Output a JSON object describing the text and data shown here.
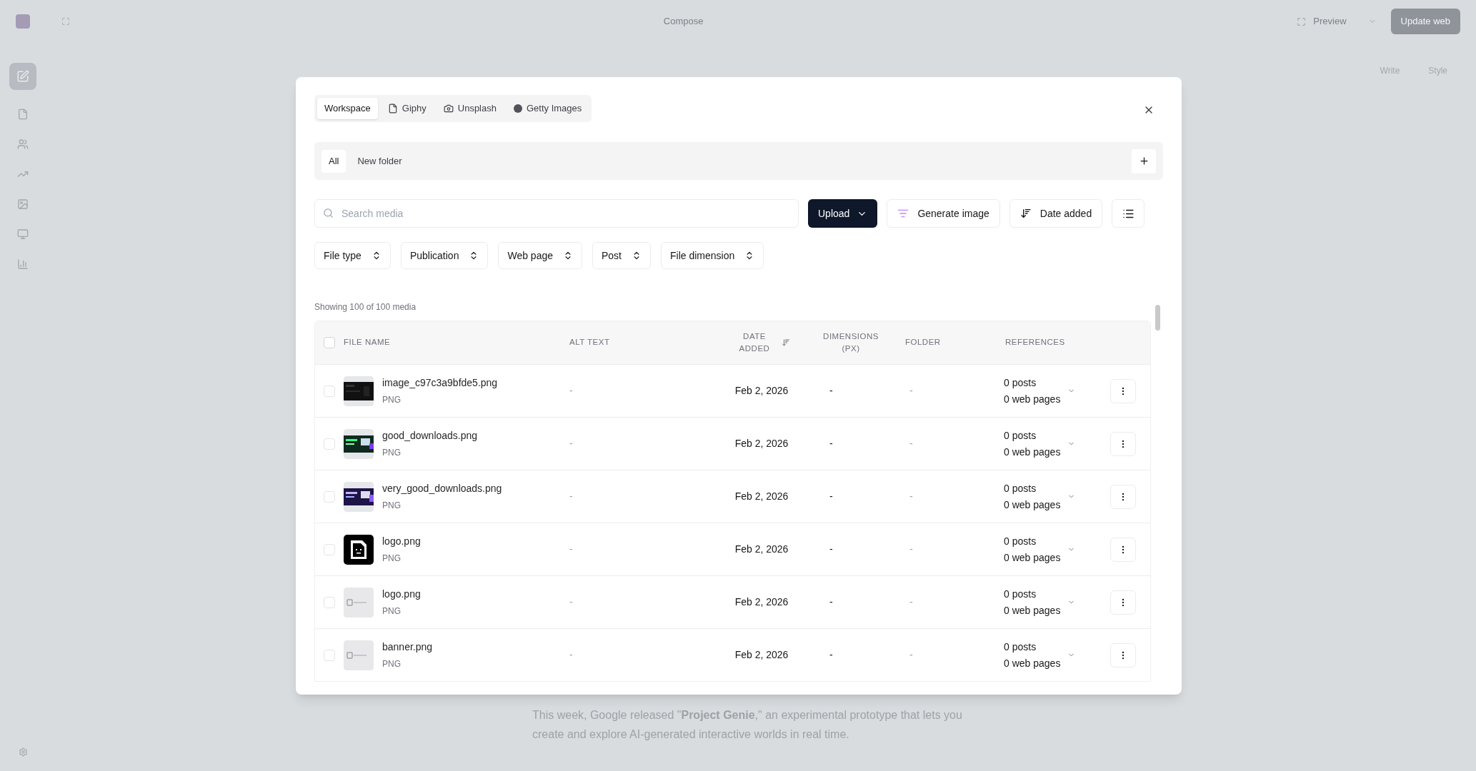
{
  "app": {
    "title": "Compose",
    "preview": "Preview",
    "update_button": "Update web",
    "panel_tabs": [
      "Write",
      "Style"
    ],
    "body_text": "This week, Google released \"**Project Genie**,\" an experimental prototype that lets you create and explore AI-generated interactive worlds in real time."
  },
  "dialog": {
    "source_tabs": [
      {
        "label": "Workspace",
        "selected": true,
        "kind": "workspace"
      },
      {
        "label": "Giphy",
        "selected": false,
        "kind": "file"
      },
      {
        "label": "Unsplash",
        "selected": false,
        "kind": "camera"
      },
      {
        "label": "Getty Images",
        "selected": false,
        "kind": "getty"
      }
    ],
    "folders": [
      {
        "label": "All",
        "selected": true
      },
      {
        "label": "New folder",
        "selected": false
      }
    ],
    "search": {
      "placeholder": "Search media"
    },
    "upload_button": "Upload",
    "generate_button": "Generate image",
    "sort_button": "Date added",
    "filters": [
      "File type",
      "Publication",
      "Web page",
      "Post",
      "File dimension"
    ],
    "count": "Showing 100 of 100 media",
    "table": {
      "select_all_checked": false,
      "columns": [
        "FILE NAME",
        "ALT TEXT",
        "DATE ADDED",
        "DIMENSIONS (PX)",
        "FOLDER",
        "REFERENCES"
      ],
      "rows": [
        {
          "name": "image_c97c3a9bfde5.png",
          "type": "PNG",
          "alt_text": "-",
          "date": "Feb 2, 2026",
          "dimensions": "-",
          "folder": "-",
          "posts": "0 posts",
          "pages": "0 web pages",
          "checked": false
        },
        {
          "name": "good_downloads.png",
          "type": "PNG",
          "alt_text": "-",
          "date": "Feb 2, 2026",
          "dimensions": "-",
          "folder": "-",
          "posts": "0 posts",
          "pages": "0 web pages",
          "checked": false
        },
        {
          "name": "very_good_downloads.png",
          "type": "PNG",
          "alt_text": "-",
          "date": "Feb 2, 2026",
          "dimensions": "-",
          "folder": "-",
          "posts": "0 posts",
          "pages": "0 web pages",
          "checked": false
        },
        {
          "name": "logo.png",
          "type": "PNG",
          "alt_text": "-",
          "date": "Feb 2, 2026",
          "dimensions": "-",
          "folder": "-",
          "posts": "0 posts",
          "pages": "0 web pages",
          "checked": false
        },
        {
          "name": "logo.png",
          "type": "PNG",
          "alt_text": "-",
          "date": "Feb 2, 2026",
          "dimensions": "-",
          "folder": "-",
          "posts": "0 posts",
          "pages": "0 web pages",
          "checked": false
        },
        {
          "name": "banner.png",
          "type": "PNG",
          "alt_text": "-",
          "date": "Feb 2, 2026",
          "dimensions": "-",
          "folder": "-",
          "posts": "0 posts",
          "pages": "0 web pages",
          "checked": false
        }
      ]
    }
  }
}
